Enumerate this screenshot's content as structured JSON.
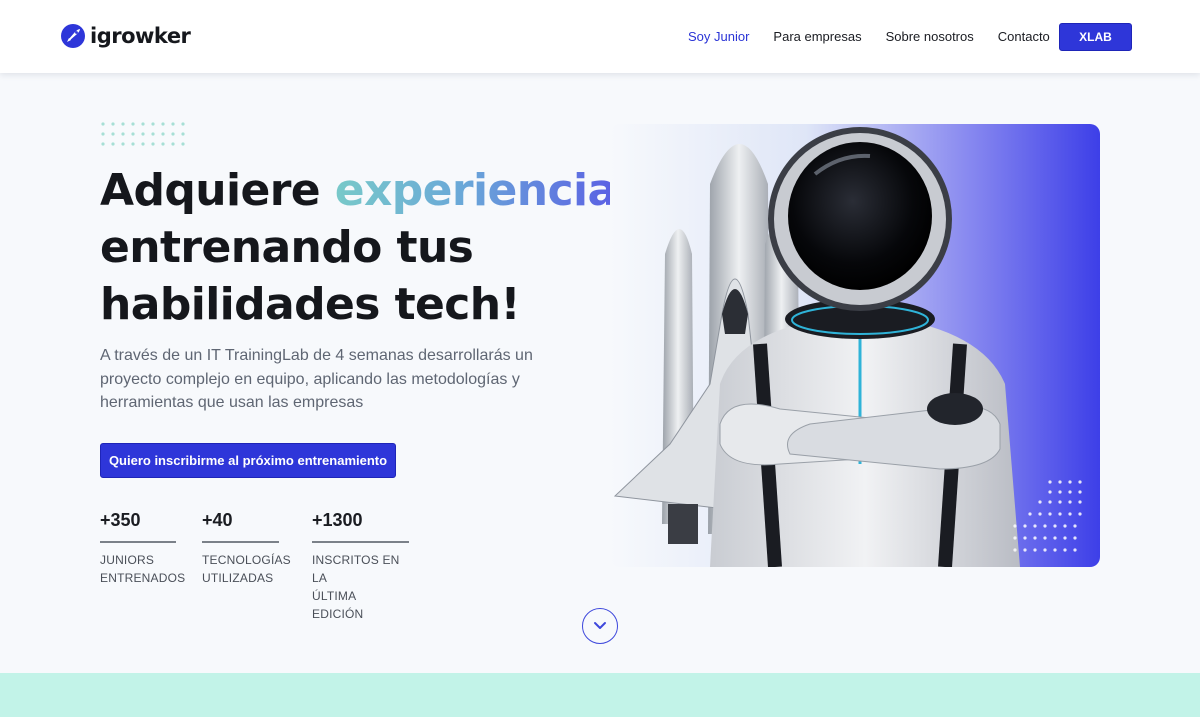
{
  "header": {
    "logo_text": "igrowker",
    "nav": [
      {
        "label": "Soy Junior",
        "active": true
      },
      {
        "label": "Para empresas",
        "active": false
      },
      {
        "label": "Sobre nosotros",
        "active": false
      },
      {
        "label": "Contacto",
        "active": false
      }
    ],
    "cta_label": "XLAB"
  },
  "hero": {
    "title_part1": "Adquiere ",
    "title_highlight": "experiencia",
    "title_line2": "entrenando tus",
    "title_line3": "habilidades tech!",
    "subtitle": "A través de un IT TrainingLab de 4 semanas desarrollarás un proyecto complejo en equipo, aplicando las metodologías y herramientas que usan las empresas",
    "cta_label": "Quiero inscribirme al próximo entrenamiento",
    "image_icon": "astronaut-rocket-illustration"
  },
  "stats": [
    {
      "value": "+350",
      "label_line1": "JUNIORS",
      "label_line2": "ENTRENADOS"
    },
    {
      "value": "+40",
      "label_line1": "TECNOLOGÍAS",
      "label_line2": "UTILIZADAS"
    },
    {
      "value": "+1300",
      "label_line1": "INSCRITOS EN LA",
      "label_line2": "ÚLTIMA EDICIÓN"
    }
  ],
  "scroll": {
    "icon": "chevron-down-icon"
  },
  "colors": {
    "accent": "#2e36d9",
    "nav_active": "#2a34d6",
    "highlight_gradient": [
      "#78c9c9",
      "#6aa8d8",
      "#5a5fe4"
    ],
    "band": "#c2f3e8"
  }
}
